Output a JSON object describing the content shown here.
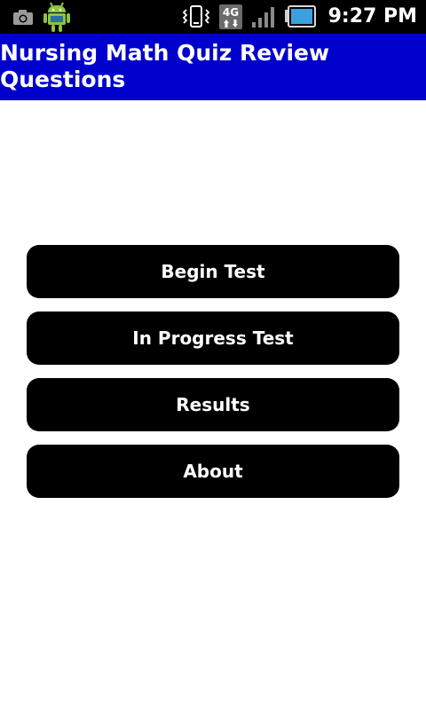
{
  "status_bar": {
    "time": "9:27 PM",
    "network_label": "4G",
    "icons": [
      "camera-icon",
      "android-icon",
      "vibrate-icon",
      "4g-icon",
      "signal-icon",
      "battery-icon"
    ]
  },
  "header": {
    "title": "Nursing Math Quiz Review Questions"
  },
  "menu": {
    "items": [
      {
        "label": "Begin Test"
      },
      {
        "label": "In Progress Test"
      },
      {
        "label": "Results"
      },
      {
        "label": "About"
      }
    ]
  },
  "colors": {
    "status_bar_bg": "#000000",
    "title_bar_bg": "#0000cc",
    "button_bg": "#000000",
    "button_text": "#ffffff",
    "page_bg": "#ffffff",
    "battery_fill": "#3aa0e0"
  }
}
